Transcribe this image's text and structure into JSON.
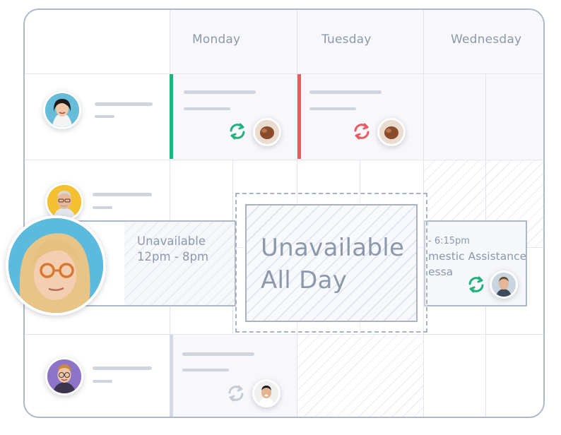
{
  "days": [
    "Monday",
    "Tuesday",
    "Wednesday"
  ],
  "unavailable_partial": {
    "label": "Unavailable",
    "time": "12pm - 8pm"
  },
  "unavailable_all_day": {
    "line1": "Unavailable",
    "line2": "All Day"
  },
  "shift_card": {
    "time": "- 6:15pm",
    "title": "mestic Assistance",
    "subtitle": "essa"
  },
  "colors": {
    "success_accent": "#22b07d",
    "error_accent": "#ea5a5f",
    "sync_green": "#22b07d",
    "sync_red": "#ea5a5f",
    "sync_grey": "#c6ccd6",
    "muted_text": "#8c98ab"
  },
  "icons": [
    "sync-icon",
    "avatar"
  ]
}
